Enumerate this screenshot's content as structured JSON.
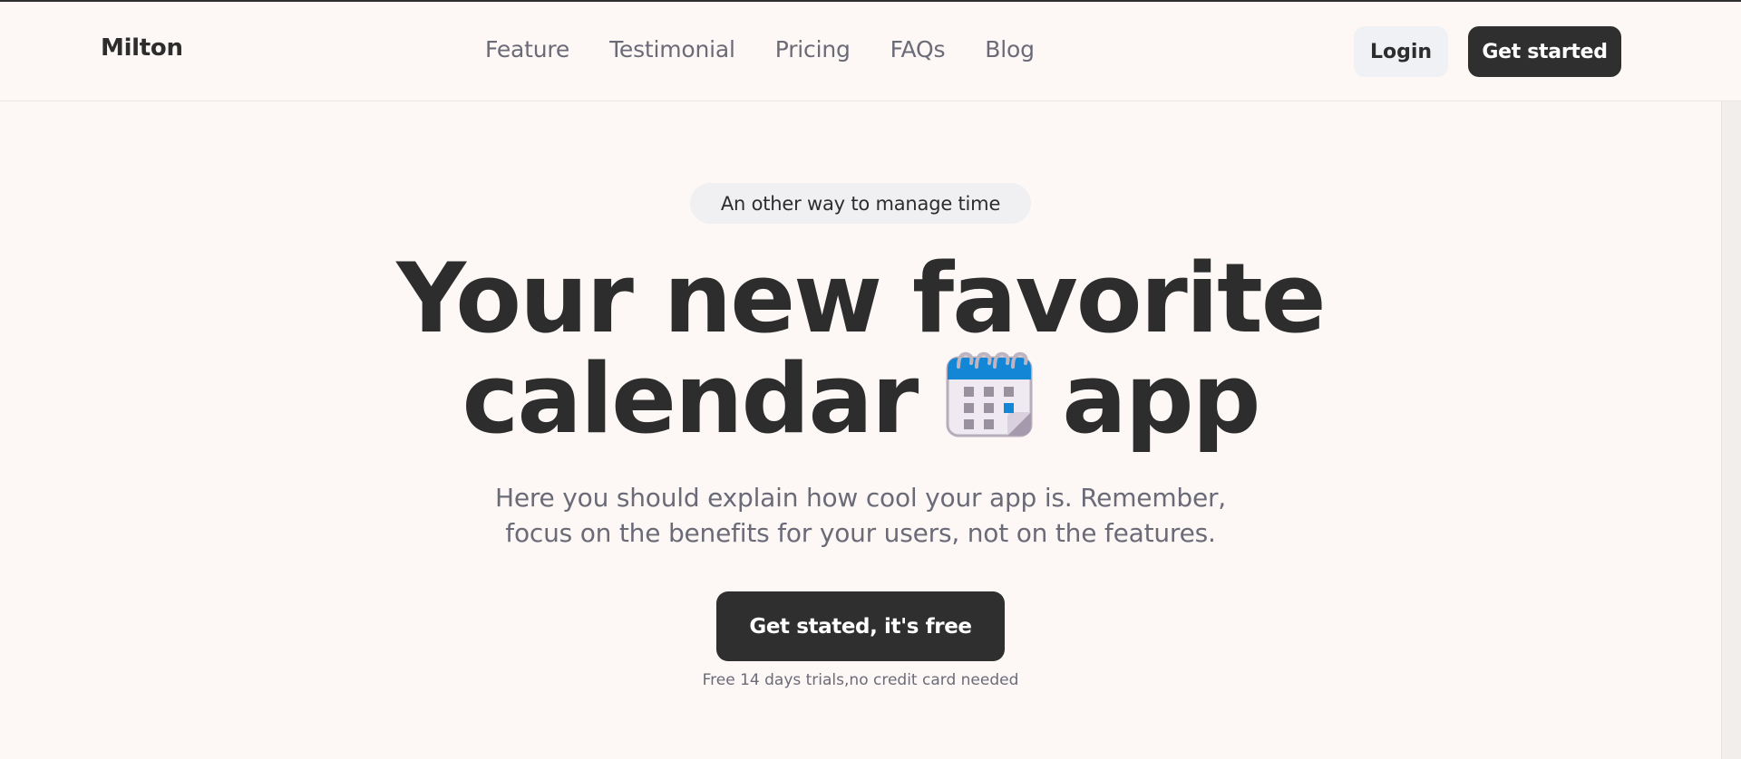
{
  "header": {
    "logo": "Milton",
    "nav": [
      "Feature",
      "Testimonial",
      "Pricing",
      "FAQs",
      "Blog"
    ],
    "login_label": "Login",
    "get_started_label": "Get started"
  },
  "hero": {
    "badge": "An other way to manage time",
    "headline_line1": "Your new favorite",
    "headline_line2_before": "calendar",
    "headline_line2_after": "app",
    "headline_icon": "calendar-icon",
    "subtitle_line1": "Here you should explain how cool your app is. Remember,",
    "subtitle_line2": "focus on the benefits for your users, not on the features.",
    "cta_label": "Get stated, it's free",
    "note": "Free 14 days trials,no credit card needed"
  },
  "colors": {
    "background": "#fdf8f6",
    "dark": "#2f2f2f",
    "muted_text": "#6b6b78",
    "calendar_accent": "#1387d6"
  }
}
